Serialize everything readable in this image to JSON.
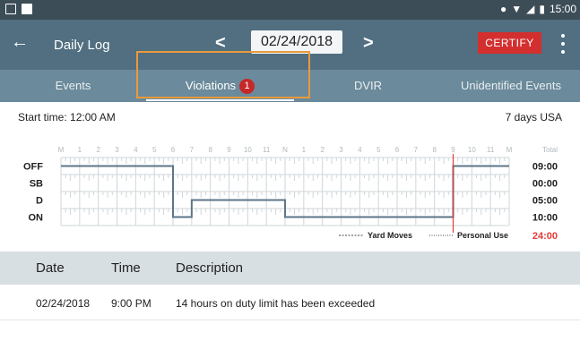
{
  "statusbar": {
    "time": "15:00"
  },
  "appbar": {
    "title": "Daily Log",
    "date": "02/24/2018",
    "certify_label": "CERTIFY",
    "prev_glyph": "<",
    "next_glyph": ">",
    "back_glyph": "←"
  },
  "tabs": [
    {
      "label": "Events"
    },
    {
      "label": "Violations",
      "badge": "1"
    },
    {
      "label": "DVIR"
    },
    {
      "label": "Unidentified Events"
    }
  ],
  "info": {
    "start_time": "Start time: 12:00 AM",
    "cycle": "7 days USA"
  },
  "chart_data": {
    "type": "line",
    "hour_labels": [
      "M",
      "1",
      "2",
      "3",
      "4",
      "5",
      "6",
      "7",
      "8",
      "9",
      "10",
      "11",
      "N",
      "1",
      "2",
      "3",
      "4",
      "5",
      "6",
      "7",
      "8",
      "9",
      "10",
      "11",
      "M"
    ],
    "rows": [
      "OFF",
      "SB",
      "D",
      "ON"
    ],
    "total_header": "Total",
    "totals": [
      "09:00",
      "00:00",
      "05:00",
      "10:00"
    ],
    "grand_total": "24:00",
    "legend": [
      "Yard Moves",
      "Personal Use"
    ],
    "x_range": [
      0,
      24
    ],
    "segments": [
      {
        "status": "OFF",
        "start": 0,
        "end": 6
      },
      {
        "status": "ON",
        "start": 6,
        "end": 7
      },
      {
        "status": "D",
        "start": 7,
        "end": 12
      },
      {
        "status": "ON",
        "start": 12,
        "end": 21
      },
      {
        "status": "OFF",
        "start": 21,
        "end": 24
      }
    ],
    "violation_hour": 21,
    "colors": {
      "line": "#5d7688",
      "violation": "#e53935",
      "grid": "#cfd6da",
      "grand_total": "#e53935"
    }
  },
  "table": {
    "headers": {
      "date": "Date",
      "time": "Time",
      "description": "Description"
    },
    "rows": [
      {
        "date": "02/24/2018",
        "time": "9:00 PM",
        "description": "14 hours on duty limit has been exceeded"
      }
    ]
  }
}
